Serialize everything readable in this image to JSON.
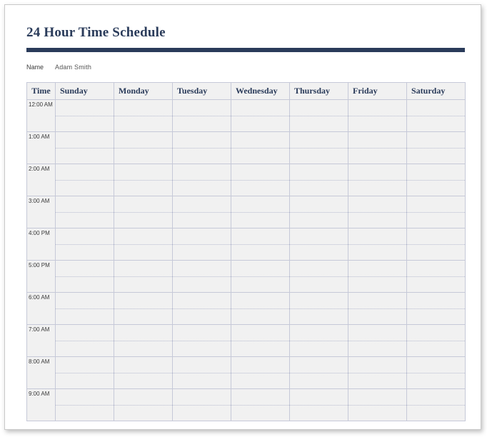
{
  "header": {
    "title": "24 Hour Time Schedule",
    "name_label": "Name",
    "name_value": "Adam Smith"
  },
  "schedule": {
    "time_header": "Time",
    "days": [
      "Sunday",
      "Monday",
      "Tuesday",
      "Wednesday",
      "Thursday",
      "Friday",
      "Saturday"
    ],
    "rows": [
      {
        "time": "12:00 AM"
      },
      {
        "time": "1:00 AM"
      },
      {
        "time": "2:00 AM"
      },
      {
        "time": "3:00 AM"
      },
      {
        "time": "4:00 PM"
      },
      {
        "time": "5:00 PM"
      },
      {
        "time": "6:00 AM"
      },
      {
        "time": "7:00 AM"
      },
      {
        "time": "8:00 AM"
      },
      {
        "time": "9:00 AM"
      }
    ]
  }
}
